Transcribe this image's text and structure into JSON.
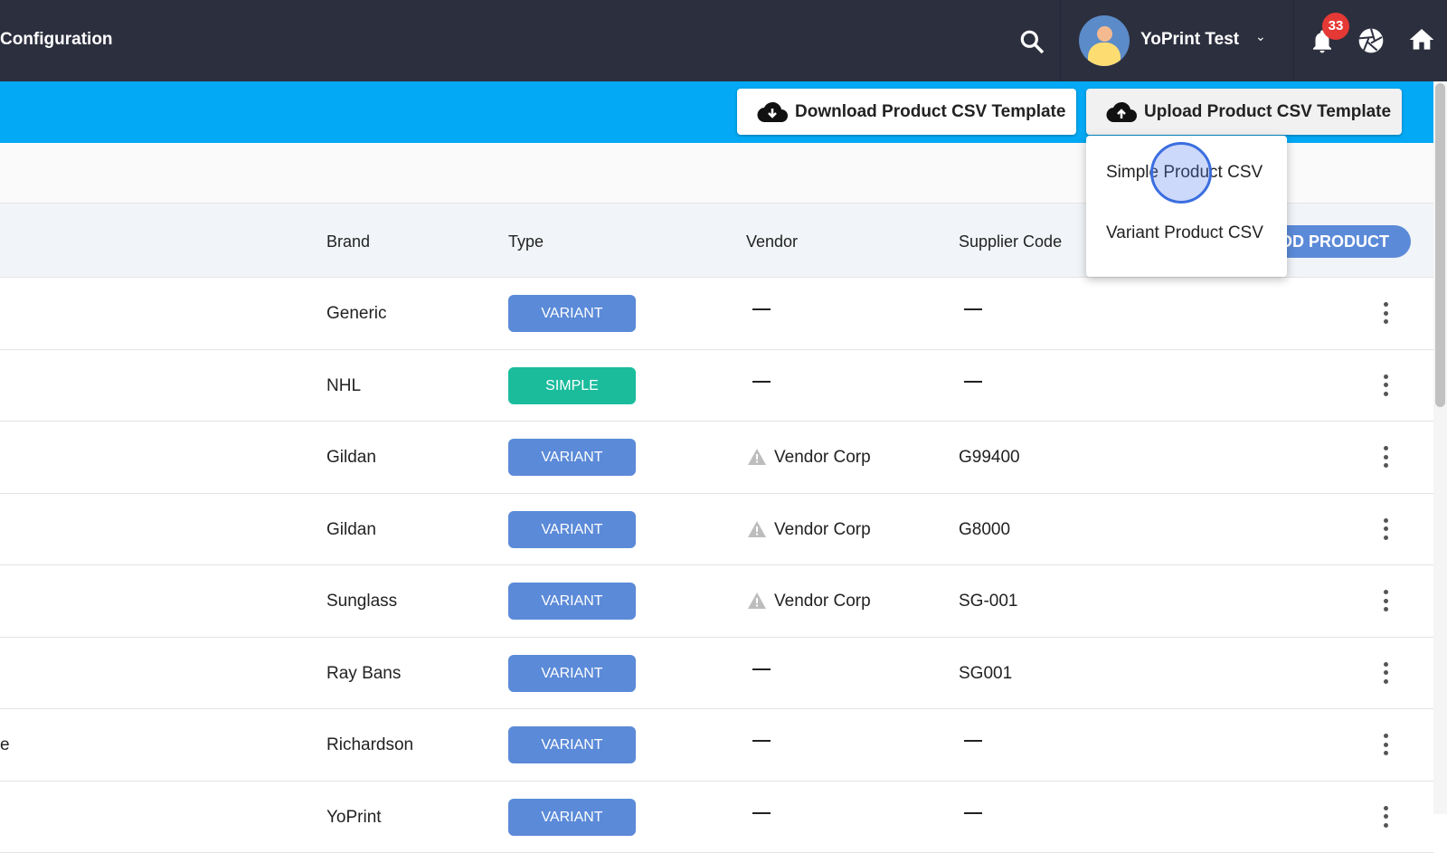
{
  "header": {
    "title": "Configuration",
    "user_name": "YoPrint Test",
    "notification_count": "33",
    "icons": [
      "search-icon",
      "avatar",
      "chevron-down-icon",
      "bell-icon",
      "aperture-icon",
      "home-icon"
    ]
  },
  "toolbar": {
    "download_label": "Download Product CSV Template",
    "upload_label": "Upload Product CSV Template"
  },
  "dropdown": {
    "items": [
      "Simple Product CSV",
      "Variant Product CSV"
    ]
  },
  "table": {
    "columns": [
      "Brand",
      "Type",
      "Vendor",
      "Supplier Code"
    ],
    "add_product_label": "DD PRODUCT",
    "rows": [
      {
        "name": "",
        "brand": "Generic",
        "type": "VARIANT",
        "vendor": "",
        "supplier": ""
      },
      {
        "name": "",
        "brand": "NHL",
        "type": "SIMPLE",
        "vendor": "",
        "supplier": ""
      },
      {
        "name": "",
        "brand": "Gildan",
        "type": "VARIANT",
        "vendor": "Vendor Corp",
        "supplier": "G99400"
      },
      {
        "name": "",
        "brand": "Gildan",
        "type": "VARIANT",
        "vendor": "Vendor Corp",
        "supplier": "G8000"
      },
      {
        "name": "",
        "brand": "Sunglass",
        "type": "VARIANT",
        "vendor": "Vendor Corp",
        "supplier": "SG-001"
      },
      {
        "name": "",
        "brand": "Ray Bans",
        "type": "VARIANT",
        "vendor": "",
        "supplier": "SG001"
      },
      {
        "name": "e",
        "brand": "Richardson",
        "type": "VARIANT",
        "vendor": "",
        "supplier": ""
      },
      {
        "name": "",
        "brand": "YoPrint",
        "type": "VARIANT",
        "vendor": "",
        "supplier": ""
      }
    ]
  },
  "colors": {
    "topbar": "#2c2f3e",
    "accent_bar": "#03a9f4",
    "variant": "#5b8ad8",
    "simple": "#1abc9c",
    "notification": "#e53935"
  }
}
